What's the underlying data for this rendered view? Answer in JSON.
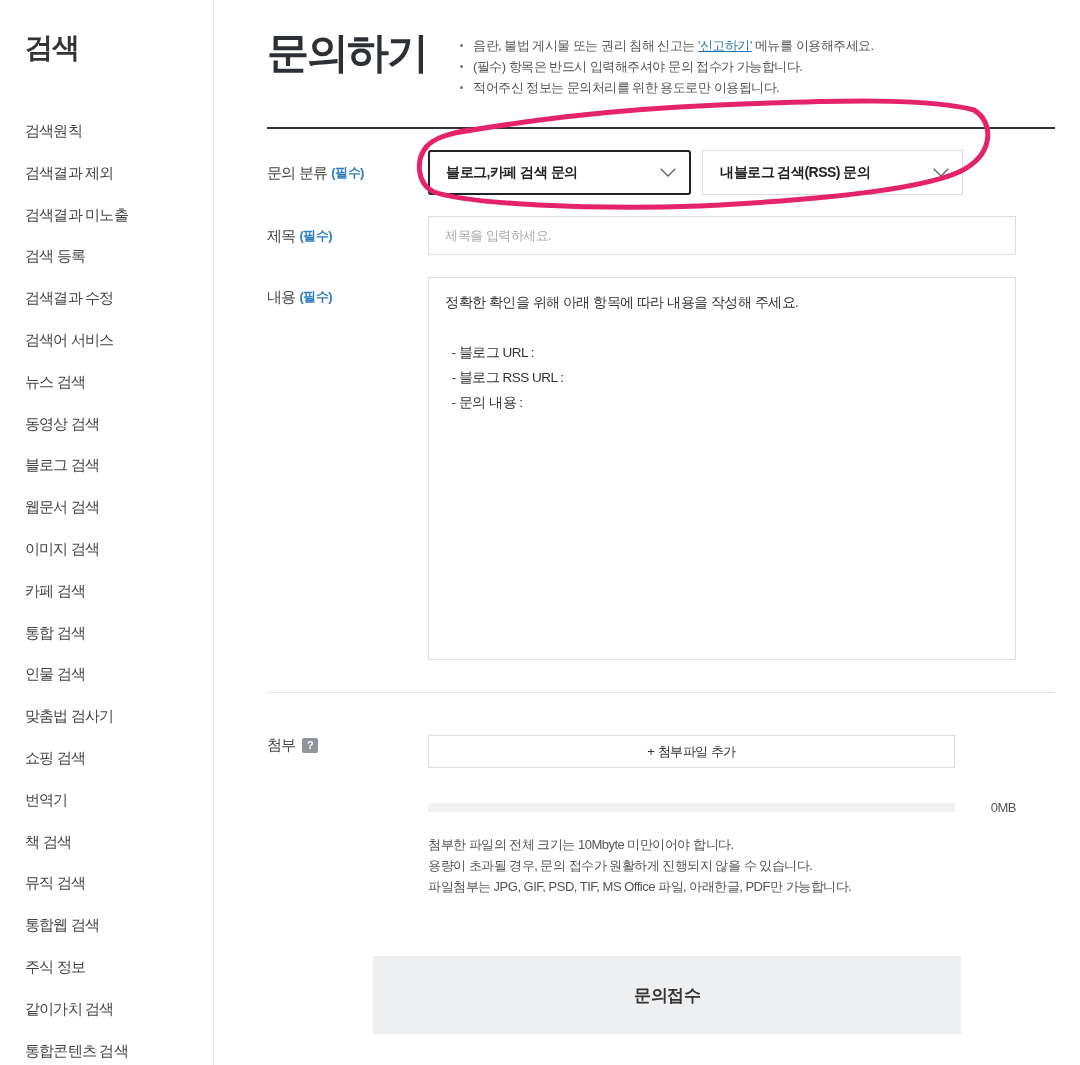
{
  "sidebar": {
    "title": "검색",
    "items": [
      "검색원칙",
      "검색결과 제외",
      "검색결과 미노출",
      "검색 등록",
      "검색결과 수정",
      "검색어 서비스",
      "뉴스 검색",
      "동영상 검색",
      "블로그 검색",
      "웹문서 검색",
      "이미지 검색",
      "카페 검색",
      "통합 검색",
      "인물 검색",
      "맞춤법 검사기",
      "쇼핑 검색",
      "번역기",
      "책 검색",
      "뮤직 검색",
      "통합웹 검색",
      "주식 정보",
      "같이가치 검색",
      "통합콘텐츠 검색"
    ]
  },
  "header": {
    "title": "문의하기",
    "notices": [
      {
        "text": "음란, 불법 게시물 또는 권리 침해 신고는 ",
        "link": "'신고하기'",
        "after": " 메뉴를 이용해주세요."
      },
      {
        "text": "(필수) 항목은 반드시 입력해주셔야 문의 접수가 가능합니다."
      },
      {
        "text": "적어주신 정보는 문의처리를 위한 용도로만 이용됩니다."
      }
    ]
  },
  "form": {
    "category": {
      "label": "문의 분류",
      "required_mark": "(필수)",
      "dropdowns": [
        {
          "value": "블로그,카페 검색 문의",
          "focused": true
        },
        {
          "value": "내블로그 검색(RSS) 문의",
          "focused": false
        }
      ]
    },
    "subject": {
      "label": "제목",
      "required_mark": "(필수)",
      "placeholder": "제목을 입력하세요."
    },
    "content": {
      "label": "내용",
      "required_mark": "(필수)",
      "value": "정확한 확인을 위해 아래 항목에 따라 내용을 작성해 주세요.\n\n  - 블로그 URL :\n  - 블로그 RSS URL :\n  - 문의 내용 :"
    },
    "attachment": {
      "label": "첨부",
      "help": "?",
      "add_button": "+ 첨부파일 추가",
      "progress": {
        "level": 0
      },
      "size": "0MB",
      "notes": [
        "첨부한 파일의 전체 크기는 10Mbyte 미만이어야 합니다.",
        "용량이 초과될 경우, 문의 접수가 원활하게 진행되지 않을 수 있습니다.",
        "파일첨부는 JPG, GIF, PSD, TIF, MS Office 파일, 아래한글, PDF만 가능합니다."
      ]
    },
    "submit": "문의접수"
  },
  "annotations": [
    {
      "kind": "ellipse"
    }
  ]
}
